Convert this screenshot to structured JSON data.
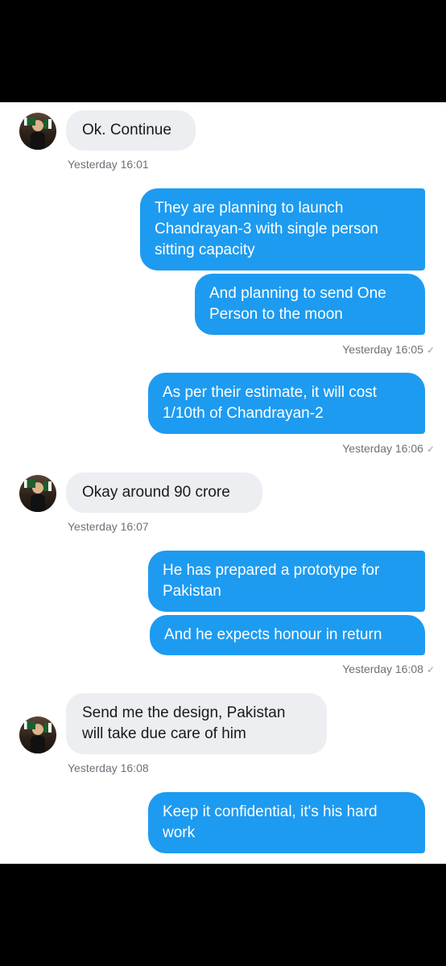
{
  "messages": [
    {
      "dir": "in",
      "text": "Ok. Continue",
      "time": "Yesterday 16:01"
    },
    {
      "dir": "out",
      "text": "They are planning to launch Chandrayan-3 with single person sitting capacity"
    },
    {
      "dir": "out",
      "text": "And planning to send One Person to the moon",
      "time": "Yesterday 16:05"
    },
    {
      "dir": "out",
      "text": "As per their estimate, it will cost 1/10th of Chandrayan-2",
      "time": "Yesterday 16:06"
    },
    {
      "dir": "in",
      "text": "Okay around 90 crore",
      "time": "Yesterday 16:07"
    },
    {
      "dir": "out",
      "text": "He has prepared a prototype for Pakistan"
    },
    {
      "dir": "out",
      "text": "And he expects honour in return",
      "time": "Yesterday 16:08"
    },
    {
      "dir": "in",
      "text": "Send me the design, Pakistan will take due care of him",
      "time": "Yesterday 16:08"
    },
    {
      "dir": "out",
      "text": "Keep it confidential, it's his hard work"
    }
  ],
  "sent_check_icon": "check-icon",
  "colors": {
    "outgoing": "#1d9bf0",
    "incoming": "#eceef1"
  }
}
